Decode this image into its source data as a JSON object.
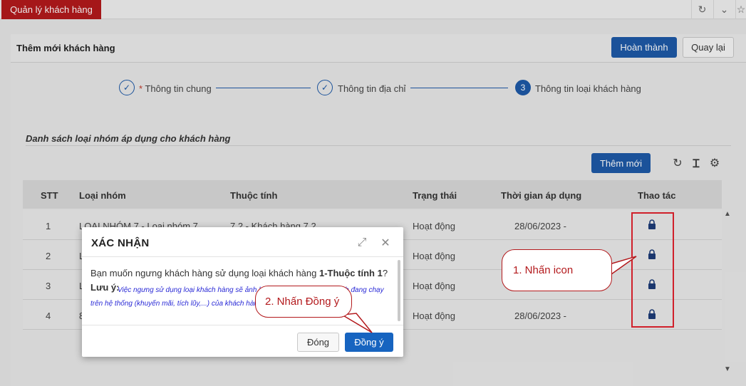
{
  "app": {
    "tab_label": "Quản lý khách hàng"
  },
  "header": {
    "title": "Thêm mới khách hàng",
    "finish_label": "Hoàn thành",
    "back_label": "Quay lại"
  },
  "steps": [
    {
      "label": "Thông tin chung",
      "required_mark": "*",
      "state": "done"
    },
    {
      "label": "Thông tin địa chỉ",
      "state": "done"
    },
    {
      "label": "Thông tin loại khách hàng",
      "number": "3",
      "state": "active"
    }
  ],
  "section": {
    "title": "Danh sách loại nhóm áp dụng cho khách hàng",
    "add_label": "Thêm mới"
  },
  "table": {
    "columns": [
      "STT",
      "Loại nhóm",
      "Thuộc tính",
      "Trạng thái",
      "Thời gian áp dụng",
      "Thao tác"
    ],
    "rows": [
      {
        "stt": "1",
        "group": "LOẠI NHÓM 7 - Loại nhóm 7",
        "attr": "7.2 - Khách hàng 7.2",
        "status": "Hoạt động",
        "time": "28/06/2023 -"
      },
      {
        "stt": "2",
        "group": "L",
        "attr": "",
        "status": "Hoạt động",
        "time": ""
      },
      {
        "stt": "3",
        "group": "L",
        "attr": "",
        "status": "Hoạt động",
        "time": ""
      },
      {
        "stt": "4",
        "group": "8",
        "attr": "",
        "status": "Hoạt động",
        "time": "28/06/2023 -"
      }
    ]
  },
  "dialog": {
    "title": "XÁC NHẬN",
    "message_prefix": "Bạn muốn ngưng khách hàng sử dụng loại khách hàng ",
    "message_bold": "1-Thuộc tính 1",
    "message_suffix": "?",
    "note_label": "Lưu ý:",
    "note_text": "Việc ngưng sử dụng loại khách hàng sẽ ảnh hưởng đến các chương trình đang chạy trên hệ thống (khuyến mãi, tích lũy,...) của khách hàng",
    "close_label": "Đóng",
    "confirm_label": "Đồng ý"
  },
  "annotations": {
    "callout_1": "1. Nhấn icon",
    "callout_2": "2. Nhấn Đồng ý"
  },
  "colors": {
    "brand_red": "#b3191c",
    "primary_blue": "#1e5aa8",
    "note_blue": "#2a2ad6"
  },
  "icons": {
    "row_action": "lock-icon",
    "refresh": "refresh-icon",
    "text": "text-format-icon",
    "settings": "gear-icon",
    "expand": "expand-icon",
    "close": "close-icon"
  }
}
